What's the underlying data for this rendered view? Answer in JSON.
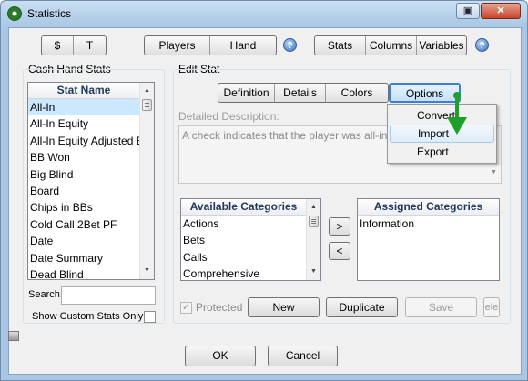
{
  "window": {
    "title": "Statistics",
    "restore_glyph": "▣",
    "close_glyph": "✕"
  },
  "top_toolbar": {
    "group1": [
      "$",
      "T"
    ],
    "group2": [
      "Players",
      "Hand"
    ],
    "group3": [
      "Stats",
      "Columns",
      "Variables"
    ],
    "help_glyph": "?"
  },
  "left_panel": {
    "title": "Cash Hand Stats",
    "list_header": "Stat Name",
    "items": [
      "All-In",
      "All-In Equity",
      "All-In Equity Adjusted BB",
      "BB Won",
      "Big Blind",
      "Board",
      "Chips in BBs",
      "Cold Call 2Bet PF",
      "Date",
      "Date Summary",
      "Dead Blind"
    ],
    "selected_index": 0,
    "search_label": "Search:",
    "search_value": "",
    "show_custom_label": "Show Custom Stats Only"
  },
  "edit_stat": {
    "title": "Edit Stat",
    "tabs": [
      "Definition",
      "Details",
      "Colors",
      "Options"
    ],
    "active_tab": "Options",
    "description_label": "Detailed Description:",
    "description_text": "A check indicates that the player was all-in at so hand.",
    "available_header": "Available Categories",
    "available_items": [
      "Actions",
      "Bets",
      "Calls",
      "Comprehensive"
    ],
    "assigned_header": "Assigned Categories",
    "assigned_items": [
      "Information"
    ],
    "move_right": ">",
    "move_left": "<",
    "protected_label": "Protected",
    "protected_checked": true,
    "buttons": {
      "new": "New",
      "duplicate": "Duplicate",
      "save": "Save",
      "delete": "ele"
    }
  },
  "options_menu": {
    "items": [
      "Convert",
      "Import",
      "Export"
    ],
    "hovered": "Import"
  },
  "footer": {
    "ok": "OK",
    "cancel": "Cancel"
  },
  "colors": {
    "annotation_arrow": "#1e9e2a",
    "titlebar": "#a9c7e4",
    "selection": "#cce8ff"
  }
}
